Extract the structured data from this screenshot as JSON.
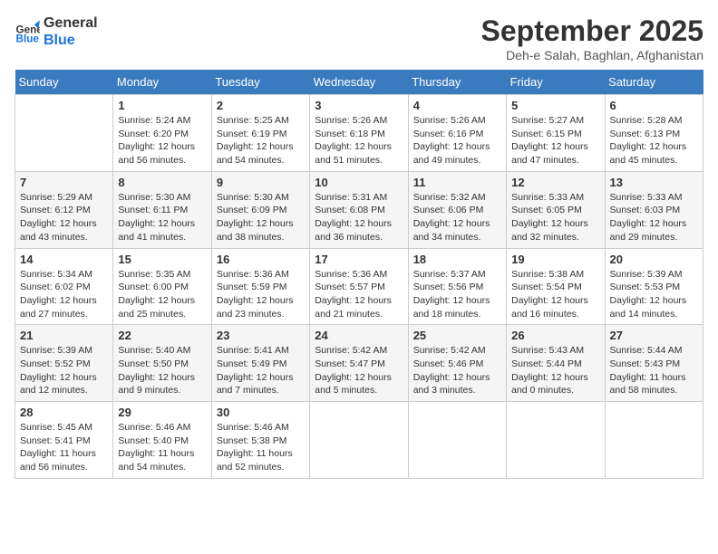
{
  "header": {
    "logo_line1": "General",
    "logo_line2": "Blue",
    "month": "September 2025",
    "location": "Deh-e Salah, Baghlan, Afghanistan"
  },
  "days_of_week": [
    "Sunday",
    "Monday",
    "Tuesday",
    "Wednesday",
    "Thursday",
    "Friday",
    "Saturday"
  ],
  "weeks": [
    [
      {
        "num": "",
        "text": ""
      },
      {
        "num": "1",
        "text": "Sunrise: 5:24 AM\nSunset: 6:20 PM\nDaylight: 12 hours\nand 56 minutes."
      },
      {
        "num": "2",
        "text": "Sunrise: 5:25 AM\nSunset: 6:19 PM\nDaylight: 12 hours\nand 54 minutes."
      },
      {
        "num": "3",
        "text": "Sunrise: 5:26 AM\nSunset: 6:18 PM\nDaylight: 12 hours\nand 51 minutes."
      },
      {
        "num": "4",
        "text": "Sunrise: 5:26 AM\nSunset: 6:16 PM\nDaylight: 12 hours\nand 49 minutes."
      },
      {
        "num": "5",
        "text": "Sunrise: 5:27 AM\nSunset: 6:15 PM\nDaylight: 12 hours\nand 47 minutes."
      },
      {
        "num": "6",
        "text": "Sunrise: 5:28 AM\nSunset: 6:13 PM\nDaylight: 12 hours\nand 45 minutes."
      }
    ],
    [
      {
        "num": "7",
        "text": "Sunrise: 5:29 AM\nSunset: 6:12 PM\nDaylight: 12 hours\nand 43 minutes."
      },
      {
        "num": "8",
        "text": "Sunrise: 5:30 AM\nSunset: 6:11 PM\nDaylight: 12 hours\nand 41 minutes."
      },
      {
        "num": "9",
        "text": "Sunrise: 5:30 AM\nSunset: 6:09 PM\nDaylight: 12 hours\nand 38 minutes."
      },
      {
        "num": "10",
        "text": "Sunrise: 5:31 AM\nSunset: 6:08 PM\nDaylight: 12 hours\nand 36 minutes."
      },
      {
        "num": "11",
        "text": "Sunrise: 5:32 AM\nSunset: 6:06 PM\nDaylight: 12 hours\nand 34 minutes."
      },
      {
        "num": "12",
        "text": "Sunrise: 5:33 AM\nSunset: 6:05 PM\nDaylight: 12 hours\nand 32 minutes."
      },
      {
        "num": "13",
        "text": "Sunrise: 5:33 AM\nSunset: 6:03 PM\nDaylight: 12 hours\nand 29 minutes."
      }
    ],
    [
      {
        "num": "14",
        "text": "Sunrise: 5:34 AM\nSunset: 6:02 PM\nDaylight: 12 hours\nand 27 minutes."
      },
      {
        "num": "15",
        "text": "Sunrise: 5:35 AM\nSunset: 6:00 PM\nDaylight: 12 hours\nand 25 minutes."
      },
      {
        "num": "16",
        "text": "Sunrise: 5:36 AM\nSunset: 5:59 PM\nDaylight: 12 hours\nand 23 minutes."
      },
      {
        "num": "17",
        "text": "Sunrise: 5:36 AM\nSunset: 5:57 PM\nDaylight: 12 hours\nand 21 minutes."
      },
      {
        "num": "18",
        "text": "Sunrise: 5:37 AM\nSunset: 5:56 PM\nDaylight: 12 hours\nand 18 minutes."
      },
      {
        "num": "19",
        "text": "Sunrise: 5:38 AM\nSunset: 5:54 PM\nDaylight: 12 hours\nand 16 minutes."
      },
      {
        "num": "20",
        "text": "Sunrise: 5:39 AM\nSunset: 5:53 PM\nDaylight: 12 hours\nand 14 minutes."
      }
    ],
    [
      {
        "num": "21",
        "text": "Sunrise: 5:39 AM\nSunset: 5:52 PM\nDaylight: 12 hours\nand 12 minutes."
      },
      {
        "num": "22",
        "text": "Sunrise: 5:40 AM\nSunset: 5:50 PM\nDaylight: 12 hours\nand 9 minutes."
      },
      {
        "num": "23",
        "text": "Sunrise: 5:41 AM\nSunset: 5:49 PM\nDaylight: 12 hours\nand 7 minutes."
      },
      {
        "num": "24",
        "text": "Sunrise: 5:42 AM\nSunset: 5:47 PM\nDaylight: 12 hours\nand 5 minutes."
      },
      {
        "num": "25",
        "text": "Sunrise: 5:42 AM\nSunset: 5:46 PM\nDaylight: 12 hours\nand 3 minutes."
      },
      {
        "num": "26",
        "text": "Sunrise: 5:43 AM\nSunset: 5:44 PM\nDaylight: 12 hours\nand 0 minutes."
      },
      {
        "num": "27",
        "text": "Sunrise: 5:44 AM\nSunset: 5:43 PM\nDaylight: 11 hours\nand 58 minutes."
      }
    ],
    [
      {
        "num": "28",
        "text": "Sunrise: 5:45 AM\nSunset: 5:41 PM\nDaylight: 11 hours\nand 56 minutes."
      },
      {
        "num": "29",
        "text": "Sunrise: 5:46 AM\nSunset: 5:40 PM\nDaylight: 11 hours\nand 54 minutes."
      },
      {
        "num": "30",
        "text": "Sunrise: 5:46 AM\nSunset: 5:38 PM\nDaylight: 11 hours\nand 52 minutes."
      },
      {
        "num": "",
        "text": ""
      },
      {
        "num": "",
        "text": ""
      },
      {
        "num": "",
        "text": ""
      },
      {
        "num": "",
        "text": ""
      }
    ]
  ]
}
